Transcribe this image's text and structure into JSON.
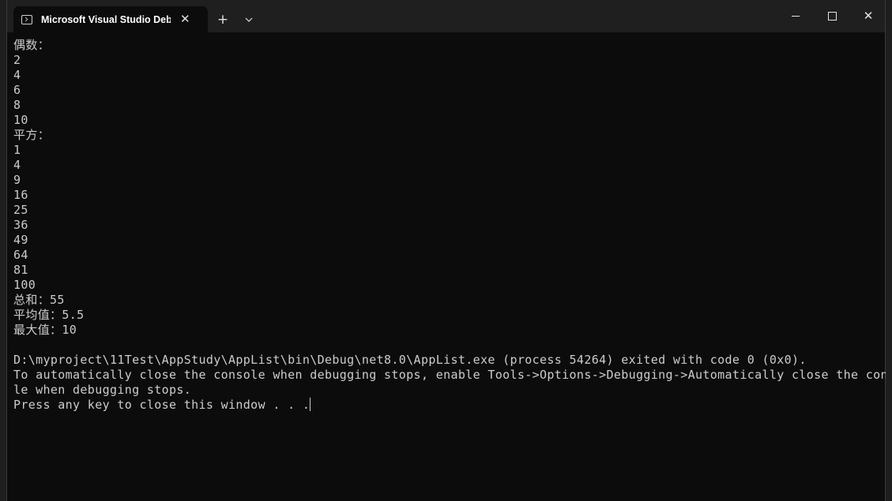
{
  "window": {
    "tab_title": "Microsoft Visual Studio Debug Console",
    "tab_close": "✕",
    "new_tab": "+",
    "tab_dropdown": "⌄",
    "close_glyph": "✕"
  },
  "console": {
    "lines": [
      "偶数：",
      "2",
      "4",
      "6",
      "8",
      "10",
      "平方：",
      "1",
      "4",
      "9",
      "16",
      "25",
      "36",
      "49",
      "64",
      "81",
      "100",
      "总和：55",
      "平均值：5.5",
      "最大值：10",
      "",
      "D:\\myproject\\11Test\\AppStudy\\AppList\\bin\\Debug\\net8.0\\AppList.exe (process 54264) exited with code 0 (0x0).",
      "To automatically close the console when debugging stops, enable Tools->Options->Debugging->Automatically close the conso",
      "le when debugging stops.",
      "Press any key to close this window . . ."
    ]
  },
  "colors": {
    "console_bg": "#0c0c0c",
    "console_fg": "#cccccc",
    "titlebar_bg": "#1f1f1f"
  },
  "icons": {
    "tab": "console-app-icon",
    "minimize": "minimize-icon",
    "maximize": "maximize-icon",
    "close": "close-icon"
  }
}
